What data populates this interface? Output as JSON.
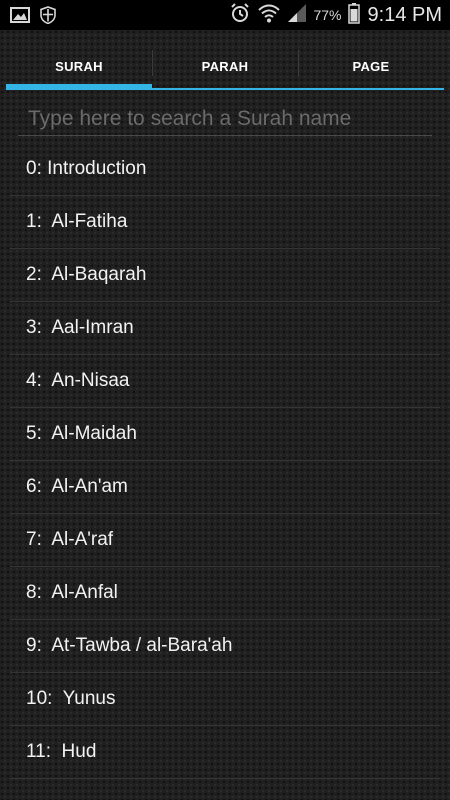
{
  "status_bar": {
    "icons_left": [
      "image-icon",
      "shield-icon"
    ],
    "icons_right": [
      "alarm-icon",
      "wifi-icon",
      "signal-icon",
      "battery-icon"
    ],
    "battery": "77%",
    "time": "9:14 PM"
  },
  "tabs": [
    {
      "label": "SURAH",
      "active": true
    },
    {
      "label": "PARAH",
      "active": false
    },
    {
      "label": "PAGE",
      "active": false
    }
  ],
  "search": {
    "placeholder": "Type here to search a Surah name",
    "value": ""
  },
  "surahs": [
    {
      "label": "0: Introduction"
    },
    {
      "label": "1:  Al-Fatiha"
    },
    {
      "label": "2:  Al-Baqarah"
    },
    {
      "label": "3:  Aal-Imran"
    },
    {
      "label": "4:  An-Nisaa"
    },
    {
      "label": "5:  Al-Maidah"
    },
    {
      "label": "6:  Al-An'am"
    },
    {
      "label": "7:  Al-A'raf"
    },
    {
      "label": "8:  Al-Anfal"
    },
    {
      "label": "9:  At-Tawba / al-Bara'ah"
    },
    {
      "label": "10:  Yunus"
    },
    {
      "label": "11:  Hud"
    }
  ],
  "colors": {
    "accent": "#33b5e5",
    "background": "#202020",
    "text": "#f2f2f2"
  }
}
